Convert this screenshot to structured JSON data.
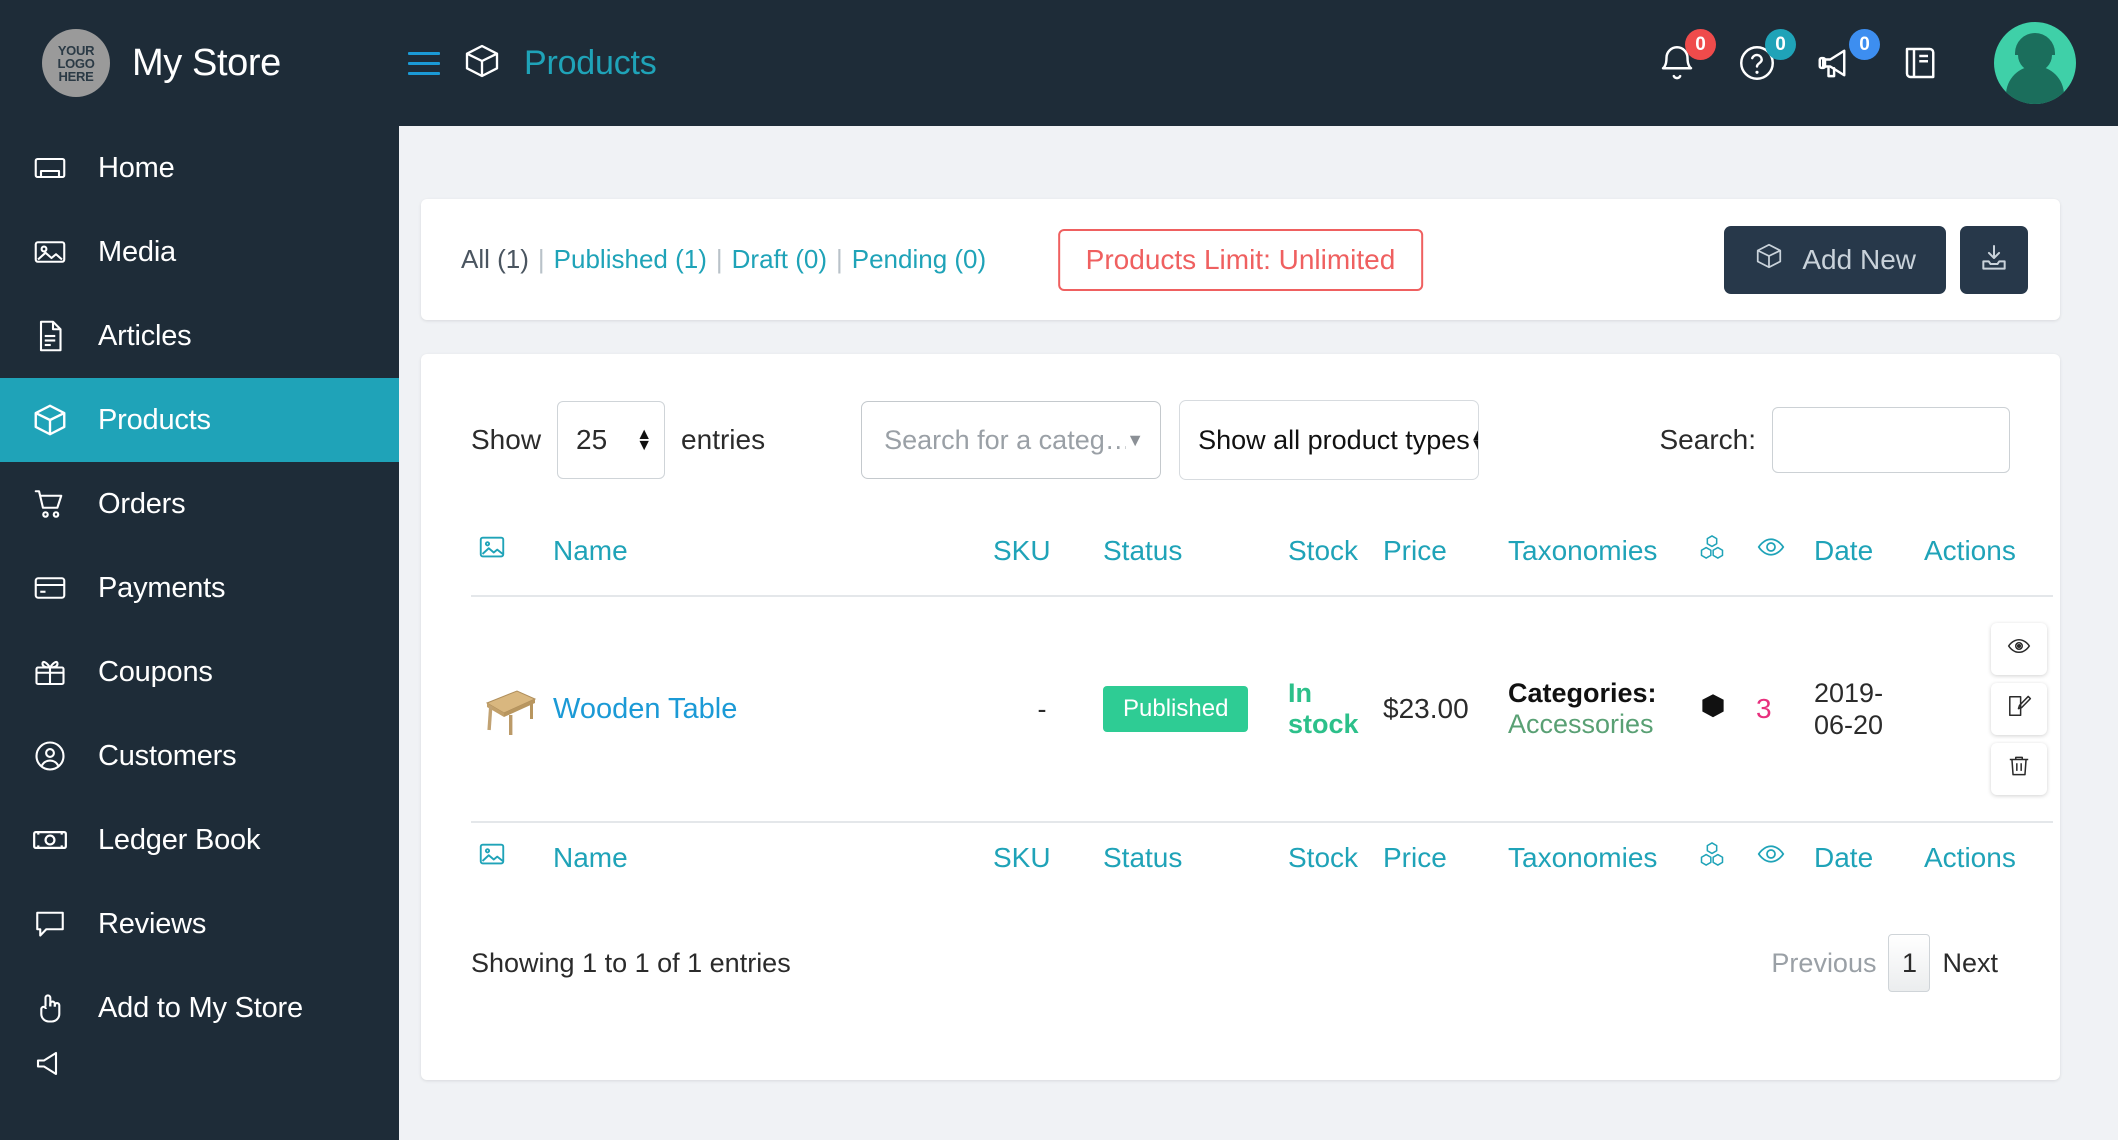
{
  "brand": {
    "logo_line1": "YOUR",
    "logo_line2": "LOGO",
    "logo_line3": "HERE",
    "store_name": "My Store"
  },
  "header": {
    "page_title": "Products",
    "menu_icon": "hamburger-icon",
    "page_icon": "box-icon",
    "notifications_badge": "0",
    "help_badge": "0",
    "announcements_badge": "0",
    "docs_icon": "book-icon",
    "avatar": "user-avatar"
  },
  "sidebar": {
    "items": [
      {
        "label": "Home",
        "icon": "home-icon",
        "active": false
      },
      {
        "label": "Media",
        "icon": "media-icon",
        "active": false
      },
      {
        "label": "Articles",
        "icon": "article-icon",
        "active": false
      },
      {
        "label": "Products",
        "icon": "box-icon",
        "active": true
      },
      {
        "label": "Orders",
        "icon": "cart-icon",
        "active": false
      },
      {
        "label": "Payments",
        "icon": "card-icon",
        "active": false
      },
      {
        "label": "Coupons",
        "icon": "gift-icon",
        "active": false
      },
      {
        "label": "Customers",
        "icon": "user-circle-icon",
        "active": false
      },
      {
        "label": "Ledger Book",
        "icon": "banknote-icon",
        "active": false
      },
      {
        "label": "Reviews",
        "icon": "chat-icon",
        "active": false
      },
      {
        "label": "Add to My Store",
        "icon": "hand-pointer-icon",
        "active": false
      }
    ]
  },
  "filterbar": {
    "status_links": [
      {
        "label": "All (1)",
        "link": false
      },
      {
        "label": "Published (1)",
        "link": true
      },
      {
        "label": "Draft (0)",
        "link": true
      },
      {
        "label": "Pending (0)",
        "link": true
      }
    ],
    "separator": "|",
    "limit_label": "Products Limit: Unlimited",
    "add_new_label": "Add New",
    "add_new_icon": "box-icon",
    "import_icon": "import-download-icon"
  },
  "controls": {
    "show_label": "Show",
    "entries_label": "entries",
    "page_length": "25",
    "category_placeholder": "Search for a categ…",
    "product_type_value": "Show all product types",
    "search_label": "Search:",
    "search_value": "",
    "search_placeholder": ""
  },
  "table": {
    "columns": [
      {
        "key": "image",
        "label": "",
        "icon": "image-icon"
      },
      {
        "key": "name",
        "label": "Name",
        "icon": ""
      },
      {
        "key": "sku",
        "label": "SKU",
        "icon": ""
      },
      {
        "key": "status",
        "label": "Status",
        "icon": ""
      },
      {
        "key": "stock",
        "label": "Stock",
        "icon": ""
      },
      {
        "key": "price",
        "label": "Price",
        "icon": ""
      },
      {
        "key": "taxonomies",
        "label": "Taxonomies",
        "icon": ""
      },
      {
        "key": "boxes",
        "label": "",
        "icon": "boxes-icon"
      },
      {
        "key": "views",
        "label": "",
        "icon": "eye-icon"
      },
      {
        "key": "date",
        "label": "Date",
        "icon": ""
      },
      {
        "key": "actions",
        "label": "Actions",
        "icon": ""
      }
    ],
    "rows": [
      {
        "thumb": "wooden-table-thumbnail",
        "name": "Wooden Table",
        "sku": "-",
        "status": "Published",
        "stock": "In stock",
        "price": "$23.00",
        "tax_label": "Categories:",
        "tax_value": "Accessories",
        "boxes_icon": "filled-box-icon",
        "views": "3",
        "date_line1": "2019-",
        "date_line2": "06-20",
        "actions": [
          {
            "name": "view-button",
            "icon": "eye-icon"
          },
          {
            "name": "edit-button",
            "icon": "pencil-square-icon"
          },
          {
            "name": "delete-button",
            "icon": "trash-icon"
          }
        ]
      }
    ]
  },
  "footer": {
    "showing": "Showing 1 to 1 of 1 entries",
    "previous": "Previous",
    "page_1": "1",
    "next": "Next"
  },
  "colors": {
    "sidebar_bg": "#1e2c38",
    "accent_teal": "#1fa3b8",
    "link_blue": "#1b9ad6",
    "limit_red": "#ef6060",
    "published_green": "#2ecc94",
    "instock_green": "#2cc08a",
    "qty_pink": "#e8307e",
    "btn_dark": "#27384a"
  }
}
